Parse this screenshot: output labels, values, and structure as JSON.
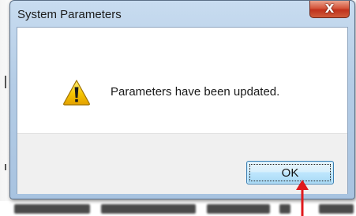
{
  "dialog": {
    "title": "System Parameters",
    "close_glyph": "X",
    "message": "Parameters have been updated.",
    "icon": "warning-icon",
    "ok_label": "OK"
  },
  "colors": {
    "warning_fill": "#f5c400",
    "close_button": "#c7452e",
    "annotation_arrow": "#e0191c"
  }
}
